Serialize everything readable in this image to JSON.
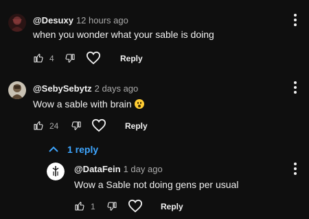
{
  "comments": [
    {
      "handle": "@Desuxy",
      "time": "12 hours ago",
      "text": "when you wonder what your sable is doing",
      "likes": "4",
      "reply_label": "Reply"
    },
    {
      "handle": "@SebySebytz",
      "time": "2 days ago",
      "text": "Wow a sable with brain",
      "emoji": "astonished-face",
      "likes": "24",
      "reply_label": "Reply",
      "replies_toggle": "1 reply",
      "replies": [
        {
          "handle": "@DataFein",
          "time": "1 day ago",
          "text": "Wow a Sable not doing gens per usual",
          "likes": "1",
          "reply_label": "Reply"
        }
      ]
    }
  ],
  "colors": {
    "background": "#0f0f0f",
    "text": "#f1f1f1",
    "secondary": "#aaaaaa",
    "link": "#3ea6ff",
    "emoji": "#ffcc33"
  }
}
